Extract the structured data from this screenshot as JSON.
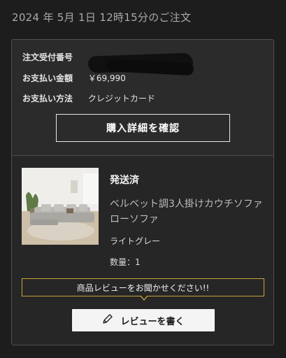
{
  "header": {
    "order_date_title": "2024 年 5月 1日 12時15分のご注文"
  },
  "order": {
    "number_label": "注文受付番号",
    "amount_label": "お支払い金額",
    "amount_value": "￥69,990",
    "method_label": "お支払い方法",
    "method_value": "クレジットカード",
    "detail_button": "購入詳細を確認"
  },
  "item": {
    "status": "発送済",
    "name": "ベルベット調3人掛けカウチソファ ローソファ",
    "color": "ライトグレー",
    "quantity": "数量：1",
    "image_icon": "sofa-photo"
  },
  "review": {
    "prompt": "商品レビューをお聞かせください!!",
    "button_label": "レビューを書く",
    "button_icon": "pen-icon",
    "accent_color": "#c9a43c"
  }
}
